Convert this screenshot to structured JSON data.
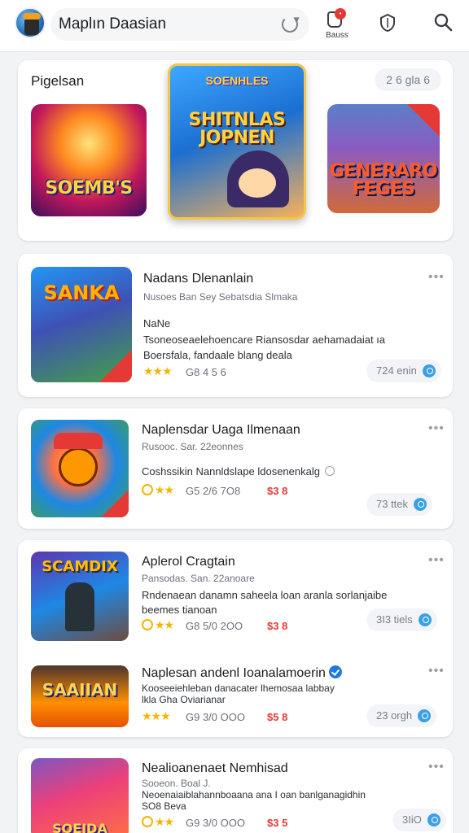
{
  "header": {
    "title": "Maplın Daasian",
    "bell_badge": "•",
    "bell_label": "Bauss"
  },
  "featured": {
    "title": "Pigelsan",
    "count": "2 6 gla  6",
    "tiles": [
      {
        "label": "SOEMB'S"
      },
      {
        "label_top": "SOENHLES",
        "label": "SHITNLAS JOPNEN"
      },
      {
        "label": "GENERARO FEGES"
      }
    ]
  },
  "apps": [
    {
      "name": "Nadans Dlenanlain",
      "sub": "Nusoes  Ban  Sey  Sebatsdia  Slmaka",
      "tag": "NaNe",
      "desc1": "Tsoneoseaelehoencare Riansosdar aehamadaiat  ıa",
      "desc2": "Boersfala,  fandaale  blang  deala",
      "stars": "★★★",
      "ratings": "G8  4 5 6",
      "price": "",
      "pill": "724 enin",
      "thumb_label": "SANKA"
    },
    {
      "name": "Naplensdar Uaga Ilmenaan",
      "sub": "Rusooc.  Sar.  22eonnes",
      "tag": "",
      "desc1": "Coshssikin Nannldslape ldosenenkalg",
      "desc2": "",
      "stars": "★★",
      "ratings": "G5  2/6  7O8",
      "price": "$3 8",
      "pill": "73 ttek",
      "thumb_label": ""
    },
    {
      "name": "Aplerol Cragtain",
      "sub": "Pansodas.  San.  22anoare",
      "tag": "",
      "desc1": "Rndenaean  danamn  saheela  loan  aranla  sorlanjaibe",
      "desc2": "beemes  tianoan",
      "stars": "★★",
      "ratings": "G8  5/0  2OO",
      "price": "$3 8",
      "pill": "3I3 tiels",
      "thumb_label": "SCAMDIX"
    },
    {
      "name": "Naplesan andenl Ioanalamoerin",
      "sub": "",
      "tag": "",
      "desc1": "Kooseeiehleban danacater lhemosaa labbay",
      "desc2": "lkla  Gha  Oviarianar",
      "stars": "★★★",
      "ratings": "G9  3/0  OOO",
      "price": "$5 8",
      "pill": "23 orgh",
      "thumb_label": "SAAIIAN"
    },
    {
      "name": "Nealioanenaet Nemhisad",
      "sub": "Sooeon.  Boal J.",
      "tag": "",
      "desc1": "Neoenaiaiblahannboaana ana  I oan  banlganagidhin",
      "desc2": "SO8  Beva",
      "stars": "★★",
      "ratings": "G9  3/0  OOO",
      "price": "$3 5",
      "pill": "3IiO",
      "thumb_label": "SOEIDA"
    }
  ],
  "colors": {
    "accent": "#1e78e6",
    "star": "#f2b600",
    "price": "#e53935"
  }
}
